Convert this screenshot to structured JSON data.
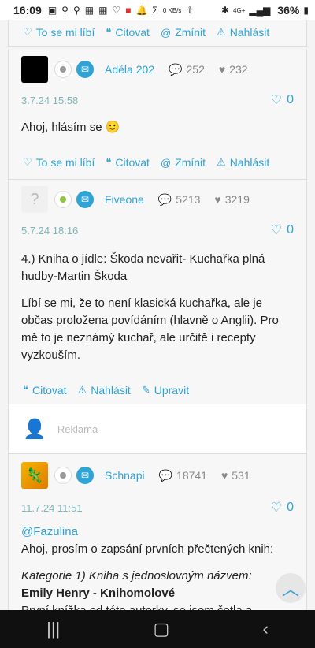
{
  "status_bar": {
    "time": "16:09",
    "battery": "36%",
    "net_speed": "0 KB/s",
    "signal": "4G+"
  },
  "actions_labels": {
    "like": "To se mi líbí",
    "quote": "Citovat",
    "mention": "Zmínit",
    "report": "Nahlásit",
    "edit": "Upravit"
  },
  "posts": [
    {
      "author": "Adéla 202",
      "comments": "252",
      "likes_given": "232",
      "date": "3.7.24 15:58",
      "like_count": "0",
      "text": "Ahoj, hlásím se"
    },
    {
      "author": "Fiveone",
      "comments": "5213",
      "likes_given": "3219",
      "date": "5.7.24 18:16",
      "like_count": "0",
      "p1": "4.) Kniha o jídle: Škoda nevařit- Kuchařka plná hudby-Martin Škoda",
      "p2": "Líbí se mi, že to není klasická kuchařka, ale je občas proložena povídáním (hlavně o Anglii). Pro mě to je neznámý kuchař, ale určitě i recepty vyzkouším."
    },
    {
      "author": "Schnapi",
      "comments": "18741",
      "likes_given": "531",
      "date": "11.7.24 11:51",
      "like_count": "0",
      "mention": "@Fazulina",
      "p1": "Ahoj, prosím o zapsání prvních přečtených knih:",
      "category": "Kategorie 1) Kniha s jednoslovným názvem:",
      "book": "Emily Henry - Knihomolové",
      "cut_text": "První knížka od této autorky, se jsem četla a"
    }
  ],
  "ad": {
    "label": "Reklama"
  },
  "colors": {
    "accent": "#2fa3d4",
    "online": "#8cc63f",
    "offline": "#999999",
    "date": "#7fb6b8"
  }
}
